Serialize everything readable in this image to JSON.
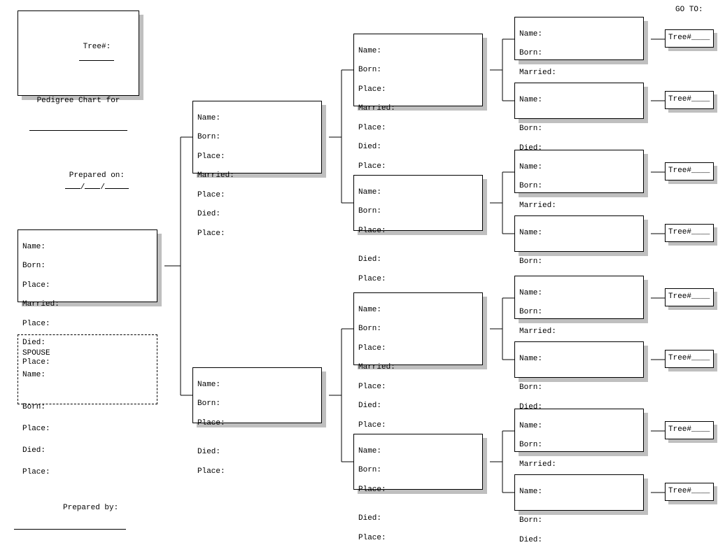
{
  "header": {
    "tree_num_label": "Tree#:",
    "title_for": "Pedigree Chart for",
    "prepared_on_label": "Prepared on:",
    "date_sep1": "/",
    "date_sep2": "/"
  },
  "goto_label": "GO TO:",
  "tree_ref_label": "Tree#____",
  "prepared_by_label": "Prepared by:",
  "spouse_label": "SPOUSE",
  "f": {
    "name": "Name:",
    "born": "Born:",
    "place": "Place:",
    "married": "Married:",
    "died": "Died:"
  }
}
